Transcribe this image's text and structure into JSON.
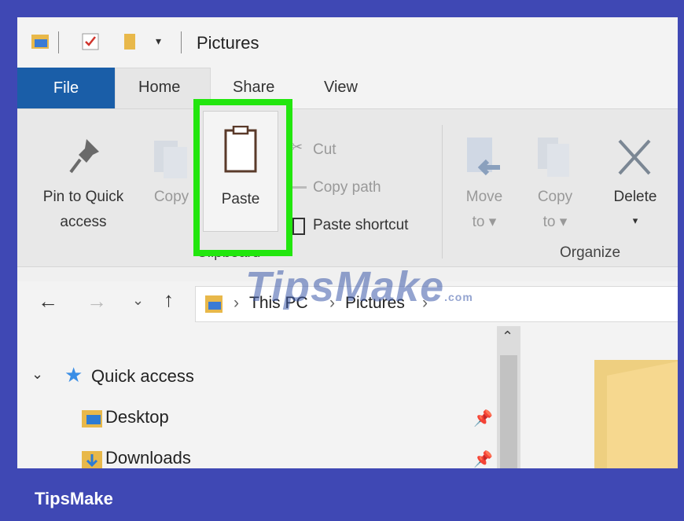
{
  "window": {
    "title": "Pictures"
  },
  "tabs": [
    {
      "label": "File"
    },
    {
      "label": "Home"
    },
    {
      "label": "Share"
    },
    {
      "label": "View"
    }
  ],
  "ribbon": {
    "pin_label_line1": "Pin to Quick",
    "pin_label_line2": "access",
    "copy_label": "Copy",
    "paste_label": "Paste",
    "cut_label": "Cut",
    "copy_path_label": "Copy path",
    "paste_shortcut_label": "Paste shortcut",
    "clipboard_group": "Clipboard",
    "move_to_line1": "Move",
    "move_to_line2": "to ▾",
    "copy_to_line1": "Copy",
    "copy_to_line2": "to ▾",
    "delete_label": "Delete",
    "delete_arrow": "▾",
    "organize_group": "Organize"
  },
  "address": {
    "crumbs": [
      "This PC",
      "Pictures"
    ]
  },
  "nav": {
    "quick_access": "Quick access",
    "items": [
      {
        "label": "Desktop"
      },
      {
        "label": "Downloads"
      }
    ]
  },
  "watermark": {
    "text": "TipsMake",
    "suffix": ".com"
  },
  "brand": {
    "label": "TipsMake"
  },
  "colors": {
    "accent": "#1a5ea8",
    "highlight": "#22e60e",
    "border": "#3f48b4"
  }
}
